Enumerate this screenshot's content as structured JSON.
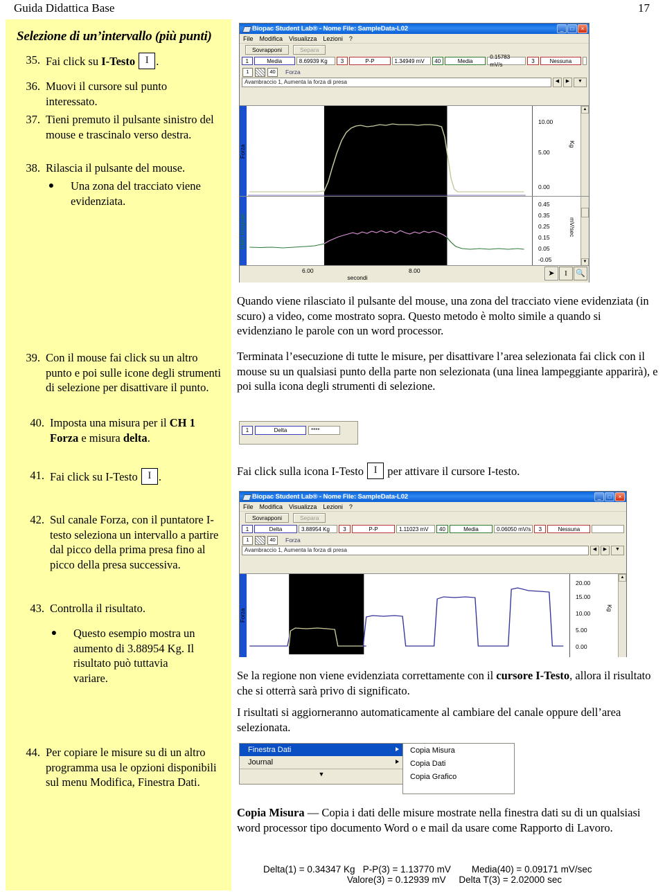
{
  "header": {
    "title": "Guida Didattica Base",
    "page_number": "17"
  },
  "sidebar": {
    "title": "Selezione di un’intervallo (più punti)",
    "steps": [
      {
        "num": "35.",
        "text_before": "Fai click su ",
        "bold": "I-Testo",
        "icon": "i-text-icon",
        "text_after": "."
      },
      {
        "num": "36.",
        "text": "Muovi il cursore sul punto interessato."
      },
      {
        "num": "37.",
        "text": "Tieni premuto il pulsante sinistro del mouse e trascinalo verso destra."
      },
      {
        "num": "38.",
        "text": "Rilascia il pulsante del mouse."
      }
    ],
    "bullet_38": "Una zona del tracciato viene evidenziata.",
    "step_39": {
      "num": "39.",
      "text": "Con il mouse fai click su un altro punto e poi sulle icone degli strumenti di selezione per disattivare il punto."
    },
    "step_40": {
      "num": "40.",
      "p1": "Imposta una misura per il ",
      "b1": "CH 1 Forza",
      "p2": " e misura ",
      "b2": "delta",
      "p3": "."
    },
    "step_41": {
      "num": "41.",
      "p1": "Fai click su I-Testo",
      "p2": "."
    },
    "step_42": {
      "num": "42.",
      "text": "Sul canale Forza, con il puntatore I-testo seleziona un intervallo a partire dal picco della prima presa fino al picco della presa successiva."
    },
    "step_43": {
      "num": "43.",
      "text": "Controlla il risultato."
    },
    "bullet_43": "Questo esempio mostra un aumento di 3.88954 Kg. Il risultato può tuttavia variare.",
    "step_44": {
      "num": "44.",
      "text": "Per copiare le misure su di un altro programma usa le opzioni disponibili sul menu Modifica, Finestra Dati."
    }
  },
  "right": {
    "para1": "Quando viene rilasciato il pulsante del mouse, una zona del tracciato viene evidenziata (in scuro) a video, come mostrato sopra. Questo metodo è molto simile a quando si evidenziano le parole con un word processor.",
    "para2": "Terminata l’esecuzione di tutte le misure, per disattivare l’area selezionata fai click con il mouse su un qualsiasi punto della parte non selezionata (una linea lampeggiante apparirà), e poi sulla icona degli strumenti di selezione.",
    "itesto_line_p1": "Fai click sulla icona I-Testo",
    "itesto_line_p2": " per attivare il cursore I-testo.",
    "para3_p1": "Se la regione non viene evidenziata correttamente con il ",
    "para3_b": "cursore I-Testo",
    "para3_p2": ", allora il risultato che si otterrà sarà privo di significato.",
    "para4": "I risultati si aggiorneranno automaticamente al cambiare del canale oppure dell’area selezionata.",
    "copia_bold": "Copia Misura",
    "copia_rest": " — Copia i dati delle misure mostrate nella finestra dati su di un qualsiasi word processor tipo documento Word o e mail da usare come Rapporto di Lavoro."
  },
  "window1": {
    "title": "Biopac Student Lab® - Nome File: SampleData-L02",
    "minimize": "_",
    "maximize": "□",
    "close": "×",
    "menus": [
      "File",
      "Modifica",
      "Visualizza",
      "Lezioni",
      "?"
    ],
    "btn_overlay": "Sovrapponi",
    "btn_split": "Separa",
    "measurements": [
      {
        "channel": "1",
        "type": "Media",
        "value": "8.69939 Kg"
      },
      {
        "channel": "3",
        "type": "P-P",
        "value": "1.34949 mV"
      },
      {
        "channel": "40",
        "type": "Media",
        "value": "0.15783 mV/s"
      },
      {
        "channel": "3",
        "type": "Nessuna",
        "value": ""
      }
    ],
    "ch_num": "1",
    "ch_rate": "40",
    "ch_label": "Forza",
    "annotation": "Avambraccio 1, Aumenta la forza di presa",
    "plot1": {
      "vlabel": "Forza",
      "unit": "Kg",
      "yticks": [
        "10.00",
        "5.00",
        "0.00"
      ]
    },
    "plot2": {
      "vlabel": "EMG Integrale",
      "unit": "mV/sec",
      "yticks": [
        "0.45",
        "0.35",
        "0.25",
        "0.15",
        "0.05",
        "-0.05"
      ]
    },
    "xticks": [
      "6.00",
      "8.00"
    ],
    "xlabel": "secondi",
    "tools": [
      "arrow-icon",
      "i-beam-icon",
      "zoom-icon"
    ]
  },
  "delta_widget": {
    "channel": "1",
    "type": "Delta",
    "value": "****"
  },
  "window2": {
    "title": "Biopac Student Lab® - Nome File: SampleData-L02",
    "menus": [
      "File",
      "Modifica",
      "Visualizza",
      "Lezioni",
      "?"
    ],
    "btn_overlay": "Sovrapponi",
    "btn_split": "Separa",
    "measurements": [
      {
        "channel": "1",
        "type": "Delta",
        "value": "3.88954 Kg"
      },
      {
        "channel": "3",
        "type": "P-P",
        "value": "1.11023 mV"
      },
      {
        "channel": "40",
        "type": "Media",
        "value": "0.06050 mV/s"
      },
      {
        "channel": "3",
        "type": "Nessuna",
        "value": ""
      }
    ],
    "ch_num": "1",
    "ch_rate": "40",
    "ch_label": "Forza",
    "annotation": "Avambraccio 1, Aumenta la forza di presa",
    "plot": {
      "vlabel": "Forza",
      "unit": "Kg",
      "yticks": [
        "20.00",
        "15.00",
        "10.00",
        "5.00",
        "0.00"
      ]
    }
  },
  "menu_screenshot": {
    "items": [
      {
        "label": "Finestra Dati",
        "selected": true
      },
      {
        "label": "Journal",
        "selected": false
      }
    ],
    "submenu": [
      "Copia Misura",
      "Copia Dati",
      "Copia Grafico"
    ]
  },
  "result_lines": {
    "line1": "Delta(1) = 0.34347 Kg   P-P(3) = 1.13770 mV        Media(40) = 0.09171 mV/sec",
    "line2": "Valore(3) = 0.12939 mV     Delta T(3) = 2.02000 sec"
  },
  "chart_data": [
    {
      "type": "line",
      "title": "Forza (window 1)",
      "ylabel": "Kg",
      "xlabel": "secondi",
      "ylim": [
        0,
        12
      ],
      "yticks": [
        10.0,
        5.0,
        0.0
      ],
      "xticks": [
        6.0,
        8.0
      ],
      "series": [
        {
          "name": "Forza",
          "values": [
            0,
            0,
            0,
            0,
            0.2,
            3,
            7,
            9.6,
            9.9,
            9.7,
            9.8,
            10,
            10,
            9.9,
            9.9,
            9.8,
            9.9,
            10,
            9.9,
            9.9,
            9.8,
            9.9,
            9.9,
            9.6,
            7,
            2,
            0.2,
            0,
            0,
            0
          ]
        }
      ],
      "highlight_region": [
        0.27,
        0.8
      ]
    },
    {
      "type": "line",
      "title": "EMG Integrale (window 1)",
      "ylabel": "mV/sec",
      "xlabel": "secondi",
      "ylim": [
        -0.05,
        0.5
      ],
      "yticks": [
        0.45,
        0.35,
        0.25,
        0.15,
        0.05,
        -0.05
      ],
      "xticks": [
        6.0,
        8.0
      ],
      "series": [
        {
          "name": "EMG Integrale",
          "values": [
            0.03,
            0.03,
            0.03,
            0.035,
            0.05,
            0.09,
            0.13,
            0.16,
            0.17,
            0.18,
            0.19,
            0.18,
            0.2,
            0.17,
            0.19,
            0.16,
            0.18,
            0.15,
            0.17,
            0.19,
            0.17,
            0.16,
            0.18,
            0.15,
            0.12,
            0.07,
            0.04,
            0.03,
            0.03,
            0.03
          ]
        }
      ],
      "highlight_region": [
        0.27,
        0.8
      ]
    },
    {
      "type": "line",
      "title": "Forza (window 2)",
      "ylabel": "Kg",
      "ylim": [
        0,
        22
      ],
      "yticks": [
        20.0,
        15.0,
        10.0,
        5.0,
        0.0
      ],
      "series": [
        {
          "name": "Forza",
          "values": [
            0,
            0,
            0,
            5.3,
            5.2,
            5.2,
            5.1,
            0.1,
            0.1,
            0.1,
            9.6,
            9.8,
            9.7,
            0.1,
            0.1,
            0.1,
            15.2,
            15.0,
            15.1,
            0.1,
            0.1,
            0.1,
            18.2,
            17.4,
            17.2,
            0.1,
            0.1,
            0
          ]
        }
      ],
      "highlight_region": [
        0.13,
        0.38
      ]
    }
  ]
}
